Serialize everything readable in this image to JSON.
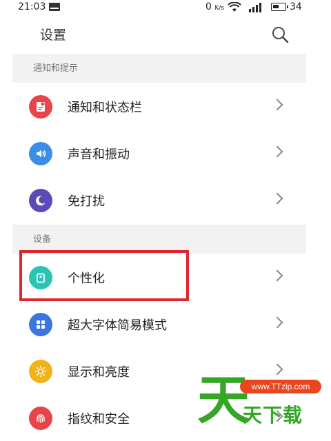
{
  "status_bar": {
    "time": "21:03",
    "net_speed": "0",
    "net_speed_unit": "K/s",
    "battery_level": "34"
  },
  "header": {
    "title": "设置"
  },
  "sections": [
    {
      "title": "通知和提示",
      "items": [
        {
          "label": "通知和状态栏",
          "icon": "notification-icon",
          "color": "#e8444a"
        },
        {
          "label": "声音和振动",
          "icon": "sound-icon",
          "color": "#3a8ee6"
        },
        {
          "label": "免打扰",
          "icon": "moon-icon",
          "color": "#5b4ab8"
        }
      ]
    },
    {
      "title": "设备",
      "items": [
        {
          "label": "个性化",
          "icon": "personalize-icon",
          "color": "#28c4b4"
        },
        {
          "label": "超大字体简易模式",
          "icon": "grid-icon",
          "color": "#3a76e0"
        },
        {
          "label": "显示和亮度",
          "icon": "brightness-icon",
          "color": "#f2b21b"
        },
        {
          "label": "指纹和安全",
          "icon": "fingerprint-icon",
          "color": "#e8444a"
        }
      ]
    }
  ],
  "watermark": {
    "big_char": "天",
    "url": "www.TTzip.com",
    "text": "天下载"
  },
  "colors": {
    "highlight": "#e0262c",
    "watermark_green": "#35a625",
    "watermark_orange": "#e9451f"
  }
}
